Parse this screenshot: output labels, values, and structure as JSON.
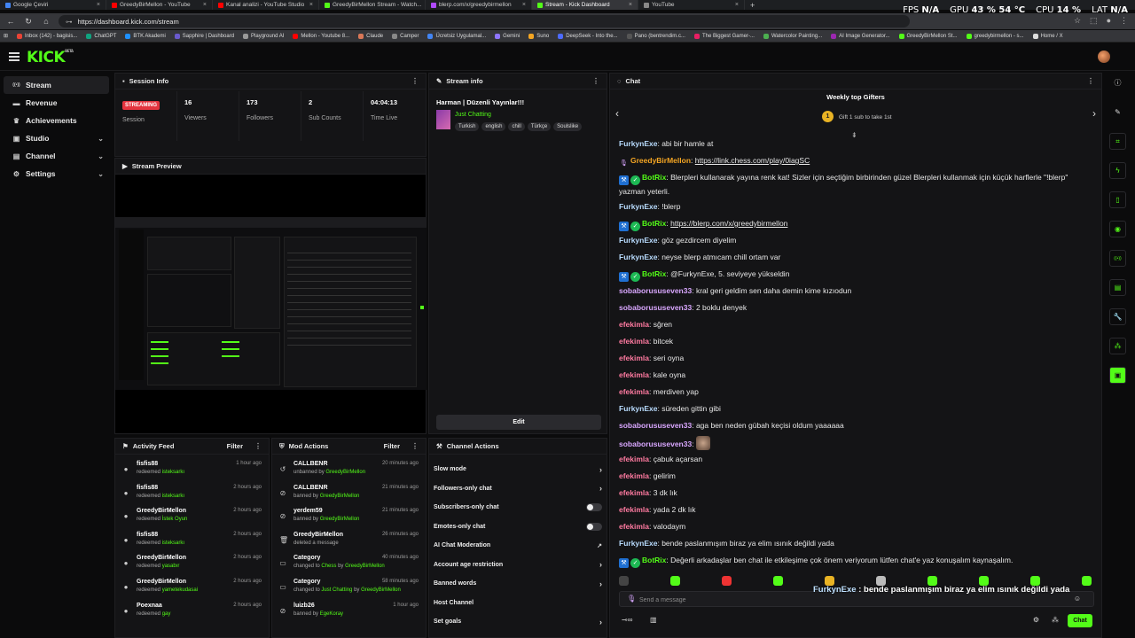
{
  "browser": {
    "tabs": [
      {
        "label": "Google Çeviri",
        "color": "#4285f4"
      },
      {
        "label": "GreedyBirMellon - YouTube",
        "color": "#ff0000"
      },
      {
        "label": "Kanal analizi - YouTube Studio",
        "color": "#ff0000"
      },
      {
        "label": "GreedyBirMellon Stream - Watch...",
        "color": "#53fc18"
      },
      {
        "label": "blerp.com/x/greedybirmellon",
        "color": "#b04aff"
      },
      {
        "label": "Stream - Kick Dashboard",
        "color": "#53fc18"
      },
      {
        "label": "YouTube",
        "color": "#888888"
      }
    ],
    "url": "https://dashboard.kick.com/stream",
    "bookmarks": [
      "Inbox (142) - bagisis...",
      "ChatGPT",
      "BTK Akademi",
      "Sapphire | Dashboard",
      "Playground AI",
      "Mellon - Youtube 8...",
      "Claude",
      "Camper",
      "Ücretsiz Uygulamal...",
      "Gemini",
      "Suno",
      "DeepSeek - Into the...",
      "Pano (bentrendim.c...",
      "The Biggest Gamer-...",
      "Watercolor Painting...",
      "AI Image Generator...",
      "GreedyBirMellon St...",
      "greedybirmellon - s...",
      "Home / X"
    ],
    "overlay": {
      "fps_label": "FPS",
      "fps_value": "N/A",
      "gpu_label": "GPU",
      "gpu_value": "43 % 54 °C",
      "cpu_label": "CPU",
      "cpu_value": "14 %",
      "lat_label": "LAT",
      "lat_value": "N/A"
    }
  },
  "kick": {
    "logo": "KICK",
    "logo_sup": "BETA"
  },
  "sidebar": {
    "items": [
      {
        "label": "Stream",
        "icon": "broadcast-icon",
        "glyph": "((•))",
        "active": true
      },
      {
        "label": "Revenue",
        "icon": "wallet-icon",
        "glyph": "▬"
      },
      {
        "label": "Achievements",
        "icon": "trophy-icon",
        "glyph": "♛"
      },
      {
        "label": "Studio",
        "icon": "monitor-icon",
        "glyph": "▣",
        "chevron": "⌄"
      },
      {
        "label": "Channel",
        "icon": "tv-icon",
        "glyph": "▤",
        "chevron": "⌄"
      },
      {
        "label": "Settings",
        "icon": "gear-icon",
        "glyph": "⚙",
        "chevron": "⌄"
      }
    ]
  },
  "session": {
    "title": "Session Info",
    "status": "STREAMING",
    "stats": [
      {
        "value": "",
        "label": "Session"
      },
      {
        "value": "16",
        "label": "Viewers"
      },
      {
        "value": "173",
        "label": "Followers"
      },
      {
        "value": "2",
        "label": "Sub Counts"
      },
      {
        "value": "04:04:13",
        "label": "Time Live"
      }
    ]
  },
  "stream_info": {
    "title": "Stream info",
    "stream_title": "Harman | Düzenli Yayınlar!!!",
    "category": "Just Chatting",
    "tags": [
      "Turkish",
      "english",
      "chill",
      "Türkçe",
      "Soulslike"
    ],
    "edit_label": "Edit"
  },
  "preview": {
    "title": "Stream Preview"
  },
  "activity": {
    "title": "Activity Feed",
    "filter": "Filter",
    "items": [
      {
        "name": "fisfis88",
        "action": "redeemed",
        "target": "isteksarkı",
        "time": "1 hour ago"
      },
      {
        "name": "fisfis88",
        "action": "redeemed",
        "target": "isteksarkı",
        "time": "2 hours ago"
      },
      {
        "name": "GreedyBirMellon",
        "action": "redeemed",
        "target": "İstek Oyun",
        "time": "2 hours ago"
      },
      {
        "name": "fisfis88",
        "action": "redeemed",
        "target": "isteksarkı",
        "time": "2 hours ago"
      },
      {
        "name": "GreedyBirMellon",
        "action": "redeemed",
        "target": "yasabır",
        "time": "2 hours ago"
      },
      {
        "name": "GreedyBirMellon",
        "action": "redeemed",
        "target": "yametekudasai",
        "time": "2 hours ago"
      },
      {
        "name": "Poexnaa",
        "action": "redeemed",
        "target": "gay",
        "time": "2 hours ago"
      }
    ]
  },
  "mod": {
    "title": "Mod Actions",
    "filter": "Filter",
    "items": [
      {
        "icon": "undo-icon",
        "glyph": "↺",
        "name": "CALLBENR",
        "pre": "unbanned by",
        "target": "GreedyBirMellon",
        "mid": "",
        "extra": "",
        "time": "20 minutes ago"
      },
      {
        "icon": "ban-icon",
        "glyph": "⊘",
        "name": "CALLBENR",
        "pre": "banned by",
        "target": "GreedyBirMellon",
        "mid": "",
        "extra": "",
        "time": "21 minutes ago"
      },
      {
        "icon": "ban-icon",
        "glyph": "⊘",
        "name": "yerdem59",
        "pre": "banned by",
        "target": "GreedyBirMellon",
        "mid": "",
        "extra": "",
        "time": "21 minutes ago"
      },
      {
        "icon": "trash-icon",
        "glyph": "🗑",
        "name": "GreedyBirMellon",
        "pre": "deleted a message",
        "target": "",
        "mid": "",
        "extra": "",
        "time": "26 minutes ago"
      },
      {
        "icon": "category-icon",
        "glyph": "▭",
        "name": "Category",
        "pre": "changed to",
        "target": "Chess",
        "mid": "by",
        "extra": "GreedyBirMellon",
        "time": "40 minutes ago"
      },
      {
        "icon": "category-icon",
        "glyph": "▭",
        "name": "Category",
        "pre": "changed to",
        "target": "Just Chatting",
        "mid": "by",
        "extra": "GreedyBirMellon",
        "time": "58 minutes ago"
      },
      {
        "icon": "ban-icon",
        "glyph": "⊘",
        "name": "luizb26",
        "pre": "banned by",
        "target": "EgeKoray",
        "mid": "",
        "extra": "",
        "time": "1 hour ago"
      }
    ]
  },
  "channel_actions": {
    "title": "Channel Actions",
    "items": [
      {
        "label": "Slow mode",
        "kind": "arrow"
      },
      {
        "label": "Followers-only chat",
        "kind": "arrow"
      },
      {
        "label": "Subscribers-only chat",
        "kind": "toggle"
      },
      {
        "label": "Emotes-only chat",
        "kind": "toggle"
      },
      {
        "label": "AI Chat Moderation",
        "kind": "external"
      },
      {
        "label": "Account age restriction",
        "kind": "arrow"
      },
      {
        "label": "Banned words",
        "kind": "arrow"
      },
      {
        "label": "Host Channel",
        "kind": "none"
      },
      {
        "label": "Set goals",
        "kind": "arrow"
      }
    ]
  },
  "chat": {
    "title": "Chat",
    "gifters_title": "Weekly top Gifters",
    "gift_rank": "1",
    "gift_text": "Gift 1 sub to take 1st",
    "messages": [
      {
        "user": "FurkynExe",
        "color": "#b9dcff",
        "text": "abi bir hamle at"
      },
      {
        "user": "GreedyBirMellon",
        "color": "#f5a623",
        "text": "https://link.chess.com/play/0iagSC",
        "link": true,
        "badges": [
          "mic"
        ]
      },
      {
        "user": "BotRix",
        "color": "#53fc18",
        "text": "Blerpleri kullanarak yayına renk kat! Sizler için seçtiğim birbirinden güzel Blerpleri kullanmak için küçük harflerle \"!blerp\" yazman yeterli.",
        "badges": [
          "bot",
          "verified"
        ],
        "two_line": true
      },
      {
        "user": "FurkynExe",
        "color": "#b9dcff",
        "text": "!blerp"
      },
      {
        "user": "BotRix",
        "color": "#53fc18",
        "text": "https://blerp.com/x/greedybirmellon",
        "link": true,
        "badges": [
          "bot",
          "verified"
        ]
      },
      {
        "user": "FurkynExe",
        "color": "#b9dcff",
        "text": "göz gezdircem diyelim"
      },
      {
        "user": "FurkynExe",
        "color": "#b9dcff",
        "text": "neyse blerp atmıcam chill ortam var"
      },
      {
        "user": "BotRix",
        "color": "#53fc18",
        "text": "@FurkynExe, 5. seviyeye yükseldin",
        "badges": [
          "bot",
          "verified"
        ]
      },
      {
        "user": "sobaborususeven33",
        "color": "#d9a7ff",
        "text": "kral geri geldim sen daha demin kime kızıodun"
      },
      {
        "user": "sobaborususeven33",
        "color": "#d9a7ff",
        "text": "2 boklu denyek"
      },
      {
        "user": "efekimla",
        "color": "#ff7aa0",
        "text": "sğren"
      },
      {
        "user": "efekimla",
        "color": "#ff7aa0",
        "text": "bitcek"
      },
      {
        "user": "efekimla",
        "color": "#ff7aa0",
        "text": "seri oyna"
      },
      {
        "user": "efekimla",
        "color": "#ff7aa0",
        "text": "kale oyna"
      },
      {
        "user": "efekimla",
        "color": "#ff7aa0",
        "text": "merdiven yap"
      },
      {
        "user": "FurkynExe",
        "color": "#b9dcff",
        "text": "süreden gittin gibi"
      },
      {
        "user": "sobaborususeven33",
        "color": "#d9a7ff",
        "text": "aga ben neden gübah keçisi oldum yaaaaaa"
      },
      {
        "user": "sobaborususeven33",
        "color": "#d9a7ff",
        "text": "",
        "emote": true
      },
      {
        "user": "efekimla",
        "color": "#ff7aa0",
        "text": "çabuk açarsan"
      },
      {
        "user": "efekimla",
        "color": "#ff7aa0",
        "text": "gelirim"
      },
      {
        "user": "efekimla",
        "color": "#ff7aa0",
        "text": "3 dk lık"
      },
      {
        "user": "efekimla",
        "color": "#ff7aa0",
        "text": "yada 2 dk lık"
      },
      {
        "user": "efekimla",
        "color": "#ff7aa0",
        "text": "valodaym"
      },
      {
        "user": "FurkynExe",
        "color": "#b9dcff",
        "text": "bende paslanmışım biraz ya elim ısınık değildi yada"
      },
      {
        "user": "BotRix",
        "color": "#53fc18",
        "text": "Değerli arkadaşlar ben chat ile etkileşime çok önem veriyorum lütfen chat'e yaz konuşalım kaynaşalım.",
        "badges": [
          "bot",
          "verified"
        ]
      }
    ],
    "floating": {
      "user": "FurkynExe",
      "text": "bende paslanmışım biraz ya elim ısınık değildi yada"
    },
    "input_placeholder": "Send a message",
    "send_label": "Chat"
  },
  "rail": {
    "icons": [
      {
        "name": "info-icon",
        "glyph": "ⓘ"
      },
      {
        "name": "pencil-icon",
        "glyph": "✎"
      },
      {
        "name": "scan-icon",
        "glyph": "⌗"
      },
      {
        "name": "bolt-icon",
        "glyph": "ϟ"
      },
      {
        "name": "clipboard-icon",
        "glyph": "▯"
      },
      {
        "name": "chat-bubble-icon",
        "glyph": "◉"
      },
      {
        "name": "broadcast-icon",
        "glyph": "((•))"
      },
      {
        "name": "box-icon",
        "glyph": "▤"
      },
      {
        "name": "wrench-icon",
        "glyph": "🔧"
      },
      {
        "name": "group-icon",
        "glyph": "⁂"
      },
      {
        "name": "app-icon",
        "glyph": "▣"
      }
    ]
  }
}
